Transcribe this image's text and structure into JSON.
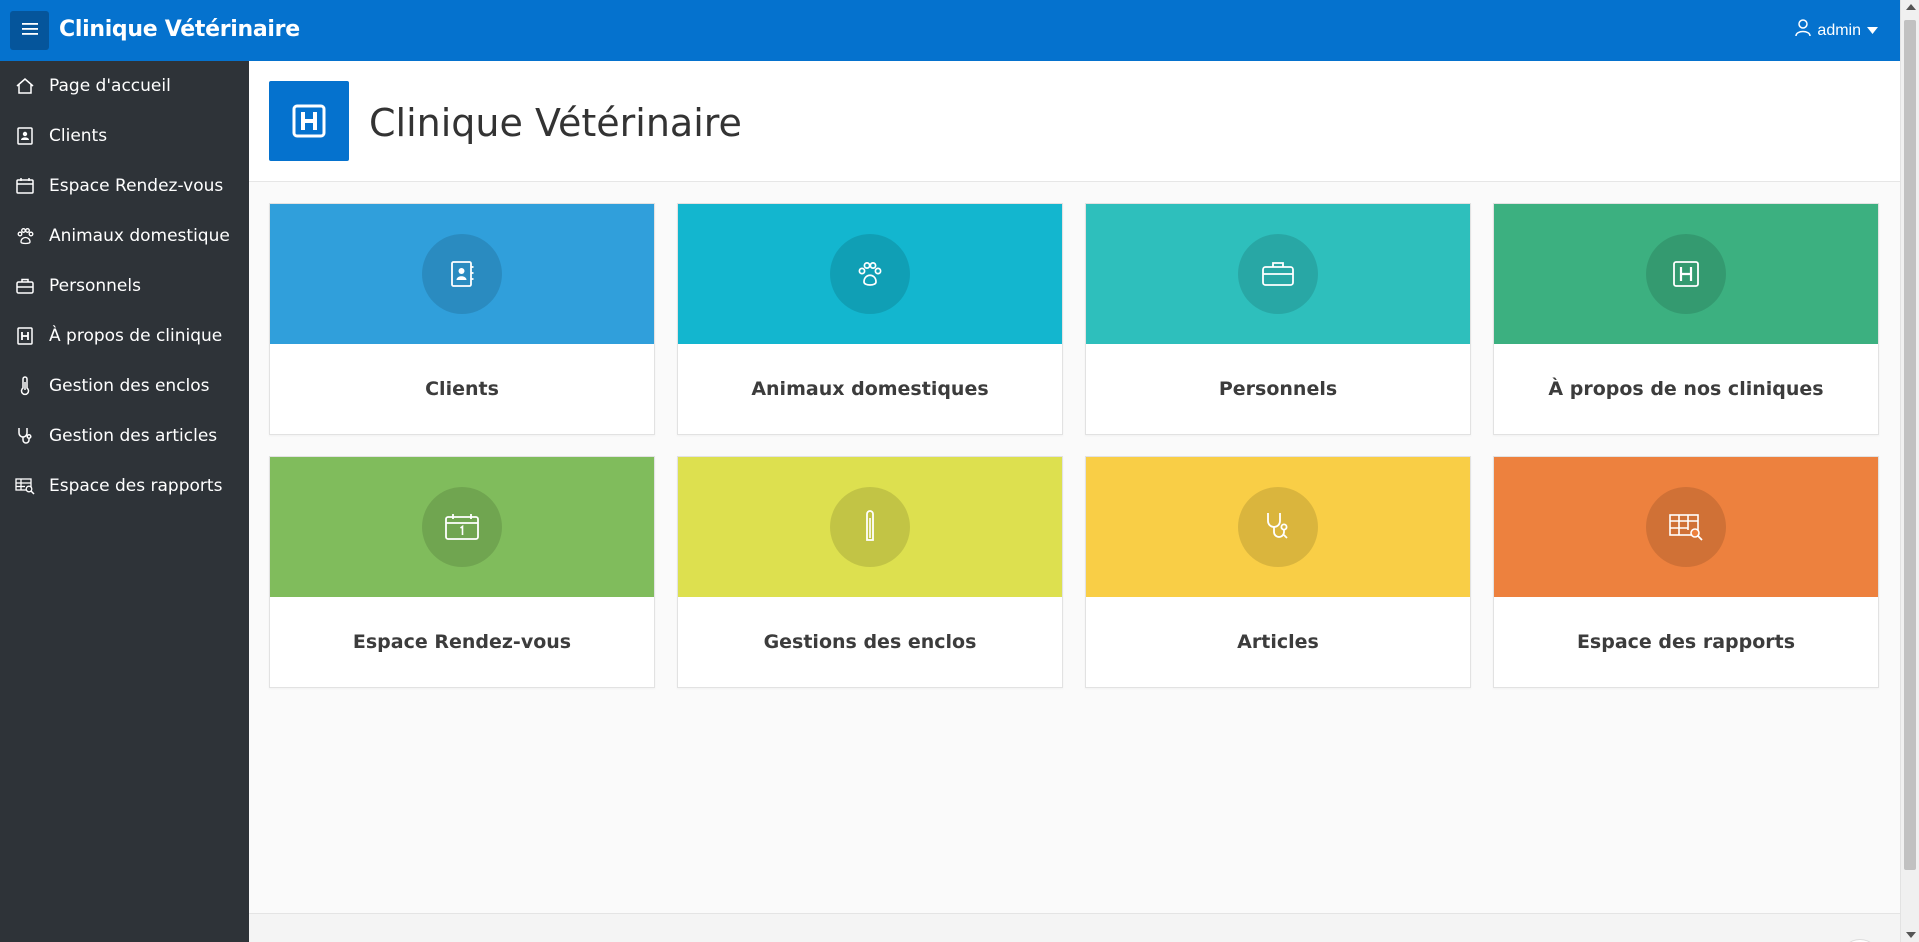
{
  "header": {
    "app_title": "Clinique Vétérinaire",
    "menu_icon": "hamburger-icon",
    "user": "admin",
    "user_icon": "user-icon",
    "caret_icon": "caret-down-icon",
    "background": "#0572ce"
  },
  "sidebar": {
    "items": [
      {
        "label": "Page d'accueil",
        "icon": "home-icon"
      },
      {
        "label": "Clients",
        "icon": "contact-book-icon"
      },
      {
        "label": "Espace Rendez-vous",
        "icon": "calendar-icon"
      },
      {
        "label": "Animaux domestique",
        "icon": "paw-icon"
      },
      {
        "label": "Personnels",
        "icon": "briefcase-icon"
      },
      {
        "label": "À propos de clinique",
        "icon": "hospital-icon"
      },
      {
        "label": "Gestion des enclos",
        "icon": "thermometer-icon"
      },
      {
        "label": "Gestion des articles",
        "icon": "stethoscope-icon"
      },
      {
        "label": "Espace des rapports",
        "icon": "table-search-icon"
      }
    ]
  },
  "hero": {
    "title": "Clinique Vétérinaire",
    "icon": "hospital-icon"
  },
  "cards": [
    {
      "label": "Clients",
      "icon": "contact-book-icon",
      "color": "#309fdb"
    },
    {
      "label": "Animaux domestiques",
      "icon": "paw-icon",
      "color": "#13b6cf"
    },
    {
      "label": "Personnels",
      "icon": "briefcase-icon",
      "color": "#2ebfbc"
    },
    {
      "label": "À propos de nos cliniques",
      "icon": "hospital-icon",
      "color": "#3cb080"
    },
    {
      "label": "Espace Rendez-vous",
      "icon": "calendar-icon",
      "color": "#80bc5c"
    },
    {
      "label": "Gestions des enclos",
      "icon": "thermometer-icon",
      "color": "#dde04f"
    },
    {
      "label": "Articles",
      "icon": "stethoscope-icon",
      "color": "#f9ce46"
    },
    {
      "label": "Espace des rapports",
      "icon": "table-search-icon",
      "color": "#ed813e"
    }
  ]
}
